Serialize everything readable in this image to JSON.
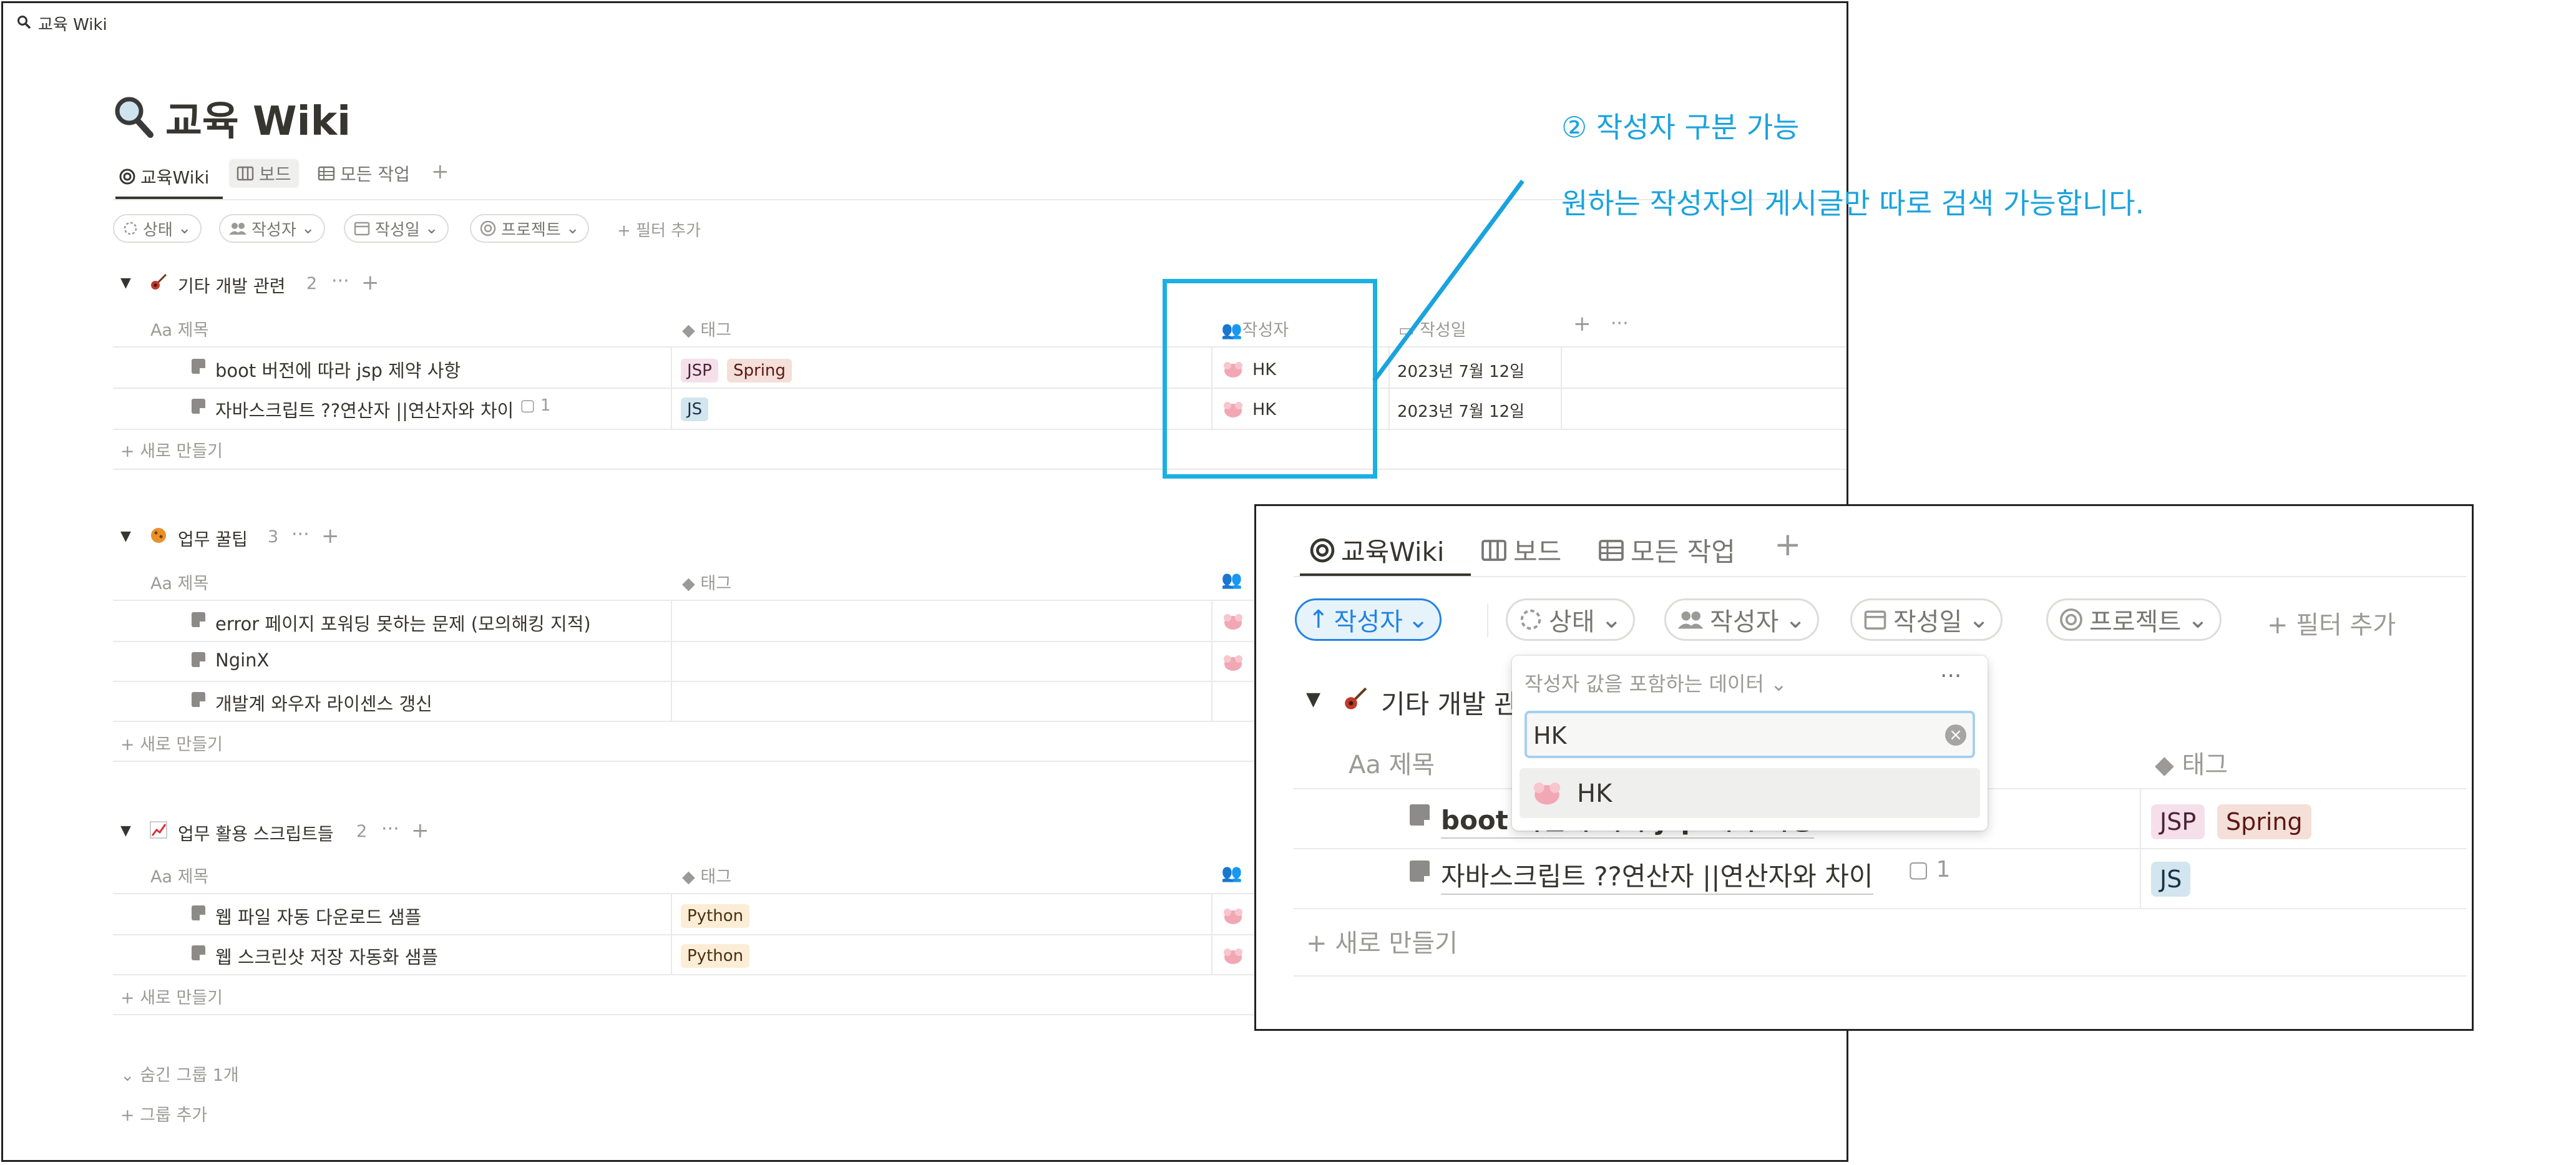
{
  "window": {
    "title": "교육 Wiki"
  },
  "page": {
    "title": "교육 Wiki"
  },
  "views": [
    {
      "label": "교육Wiki"
    },
    {
      "label": "보드"
    },
    {
      "label": "모든 작업"
    }
  ],
  "filters": {
    "status": "상태",
    "author": "작성자",
    "created": "작성일",
    "project": "프로젝트",
    "add": "필터 추가"
  },
  "columns": {
    "title": "제목",
    "title_prefix": "Aa",
    "tag": "태그",
    "author": "작성자",
    "date": "작성일"
  },
  "groups": [
    {
      "name": "기타 개발 관련",
      "count": "2",
      "rows": [
        {
          "title": "boot 버전에 따라 jsp 제약 사항",
          "tags": [
            "JSP",
            "Spring"
          ],
          "author": "HK",
          "date": "2023년 7월 12일"
        },
        {
          "title": "자바스크립트 ??연산자 ||연산자와 차이",
          "comments": "1",
          "tags": [
            "JS"
          ],
          "author": "HK",
          "date": "2023년 7월 12일"
        }
      ]
    },
    {
      "name": "업무 꿀팁",
      "count": "3",
      "rows": [
        {
          "title": "error 페이지 포워딩 못하는 문제 (모의해킹 지적)"
        },
        {
          "title": "NginX"
        },
        {
          "title": "개발계 와우자 라이센스 갱신"
        }
      ]
    },
    {
      "name": "업무 활용 스크립트들",
      "count": "2",
      "rows": [
        {
          "title": "웹 파일 자동 다운로드 샘플",
          "tags": [
            "Python"
          ]
        },
        {
          "title": "웹 스크린샷 저장 자동화 샘플",
          "tags": [
            "Python"
          ]
        }
      ]
    }
  ],
  "new_row": "새로 만들기",
  "hidden_groups": "숨긴 그룹 1개",
  "add_group": "그룹 추가",
  "annotation": {
    "heading": "② 작성자 구분 가능",
    "body": "원하는 작성자의 게시글만 따로 검색 가능합니다."
  },
  "popup": {
    "active_filter": "작성자",
    "dropdown_title": "작성자 값을 포함하는 데이터",
    "search_value": "HK",
    "option": "HK",
    "group_name": "기타 개발 관",
    "row1_title": "boot 버전에 따라 jsp 제약 사항",
    "row2_title": "자바스크립트 ??연산자 ||연산자와 차이",
    "row2_comments": "1",
    "tags_row1": [
      "JSP",
      "Spring"
    ],
    "tags_row2": [
      "JS"
    ]
  },
  "colors": {
    "annotation": "#1aa3dd",
    "highlight_box": "#1ab0e4",
    "selected_filter": "#2383e2"
  }
}
